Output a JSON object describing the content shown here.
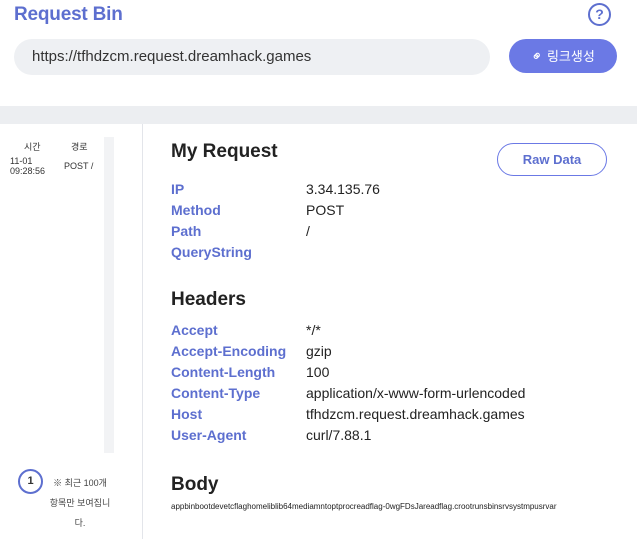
{
  "header": {
    "title": "Request Bin",
    "help_symbol": "?",
    "url": "https://tfhdzcm.request.dreamhack.games",
    "generate_button": "링크생성",
    "accent_color": "#5d6fcf",
    "button_color": "#6b79e5"
  },
  "sidebar": {
    "col_time": "시간",
    "col_route": "경로",
    "requests": [
      {
        "time": "11-01 09:28:56",
        "route": "POST /"
      }
    ],
    "page": "1",
    "note": "※ 최근 100개 항목만 보여집니다."
  },
  "request": {
    "title": "My Request",
    "raw_button": "Raw Data",
    "fields": [
      {
        "key": "IP",
        "value": "3.34.135.76"
      },
      {
        "key": "Method",
        "value": "POST"
      },
      {
        "key": "Path",
        "value": "/"
      },
      {
        "key": "QueryString",
        "value": ""
      }
    ]
  },
  "headers": {
    "title": "Headers",
    "fields": [
      {
        "key": "Accept",
        "value": "*/*"
      },
      {
        "key": "Accept-Encoding",
        "value": "gzip"
      },
      {
        "key": "Content-Length",
        "value": "100"
      },
      {
        "key": "Content-Type",
        "value": "application/x-www-form-urlencoded"
      },
      {
        "key": "Host",
        "value": "tfhdzcm.request.dreamhack.games"
      },
      {
        "key": "User-Agent",
        "value": "curl/7.88.1"
      }
    ]
  },
  "body": {
    "title": "Body",
    "content": "appbinbootdevetcflaghomeliblib64mediamntoptprocreadflag-0wgFDsJareadflag.crootrunsbinsrvsystmpusrvar"
  }
}
